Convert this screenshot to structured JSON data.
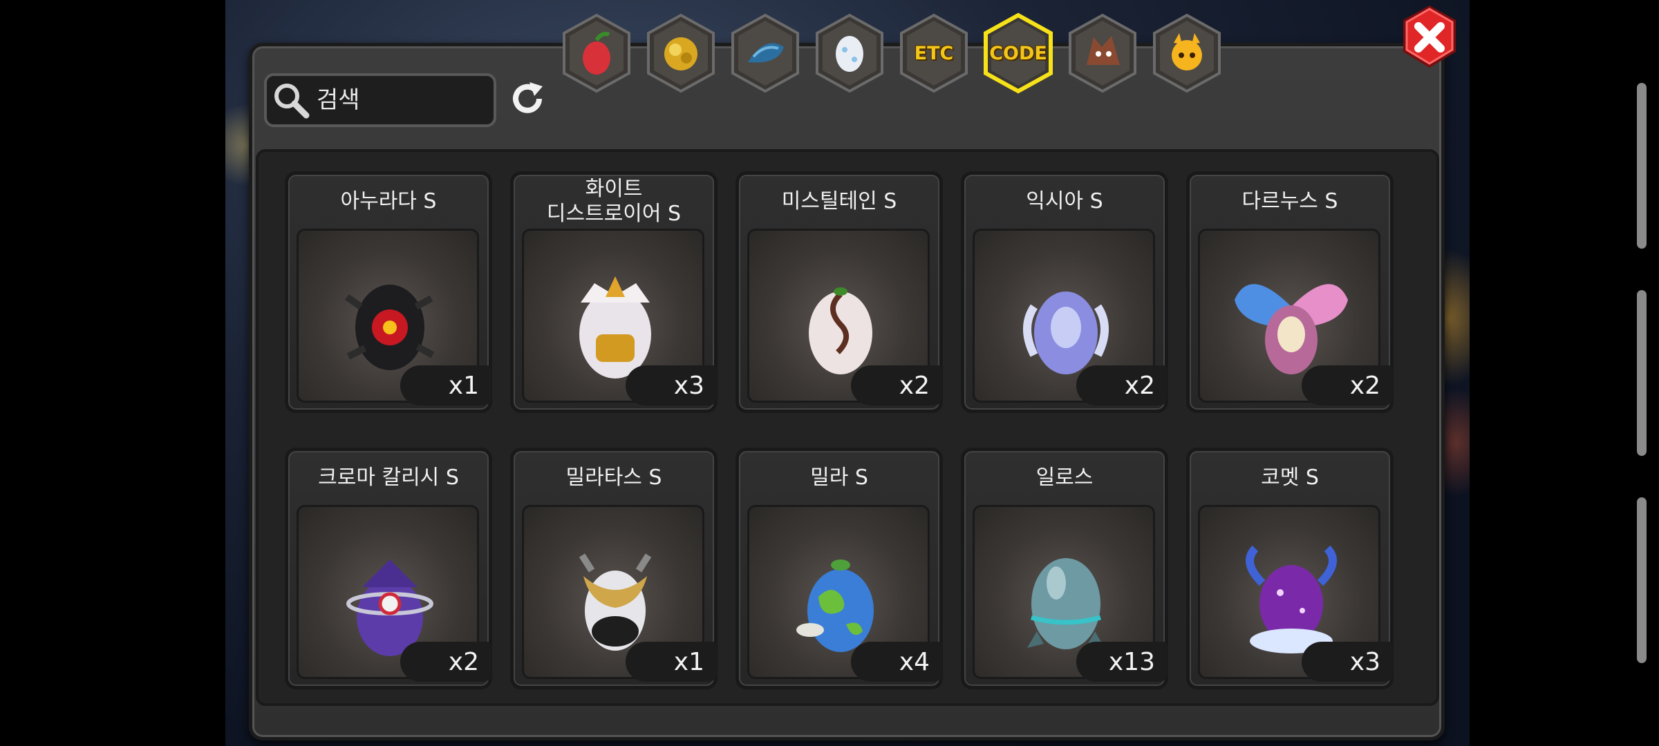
{
  "search": {
    "placeholder": "검색",
    "value": ""
  },
  "tabs": [
    {
      "id": "fruit",
      "icon": "red-fruit-icon",
      "label": "",
      "selected": false
    },
    {
      "id": "gold",
      "icon": "gold-ore-icon",
      "label": "",
      "selected": false
    },
    {
      "id": "scale",
      "icon": "blue-scale-icon",
      "label": "",
      "selected": false
    },
    {
      "id": "egg",
      "icon": "egg-icon",
      "label": "",
      "selected": false
    },
    {
      "id": "etc",
      "icon": "",
      "label": "ETC",
      "selected": false
    },
    {
      "id": "code",
      "icon": "",
      "label": "CODE",
      "selected": true
    },
    {
      "id": "wolf",
      "icon": "wolf-head-icon",
      "label": "",
      "selected": false
    },
    {
      "id": "mascot",
      "icon": "yellow-mascot-icon",
      "label": "",
      "selected": false
    }
  ],
  "colors": {
    "accent": "#f2c51c",
    "panel": "#333333",
    "close": "#d81e1e"
  },
  "items": [
    {
      "name": "아누라다 S",
      "count": "x1",
      "icon": "black-red-egg-icon"
    },
    {
      "name": "화이트\n디스트로이어 S",
      "count": "x3",
      "icon": "white-gold-armored-egg-icon"
    },
    {
      "name": "미스틸테인 S",
      "count": "x2",
      "icon": "vine-egg-icon"
    },
    {
      "name": "익시아 S",
      "count": "x2",
      "icon": "winged-crystal-egg-icon"
    },
    {
      "name": "다르누스 S",
      "count": "x2",
      "icon": "butterfly-egg-icon"
    },
    {
      "name": "크로마 칼리시 S",
      "count": "x2",
      "icon": "purple-ring-egg-icon"
    },
    {
      "name": "밀라타스 S",
      "count": "x1",
      "icon": "silver-gold-egg-icon"
    },
    {
      "name": "밀라 S",
      "count": "x4",
      "icon": "earth-egg-icon"
    },
    {
      "name": "일로스",
      "count": "x13",
      "icon": "teal-egg-icon"
    },
    {
      "name": "코멧 S",
      "count": "x3",
      "icon": "horned-galaxy-egg-icon"
    }
  ]
}
